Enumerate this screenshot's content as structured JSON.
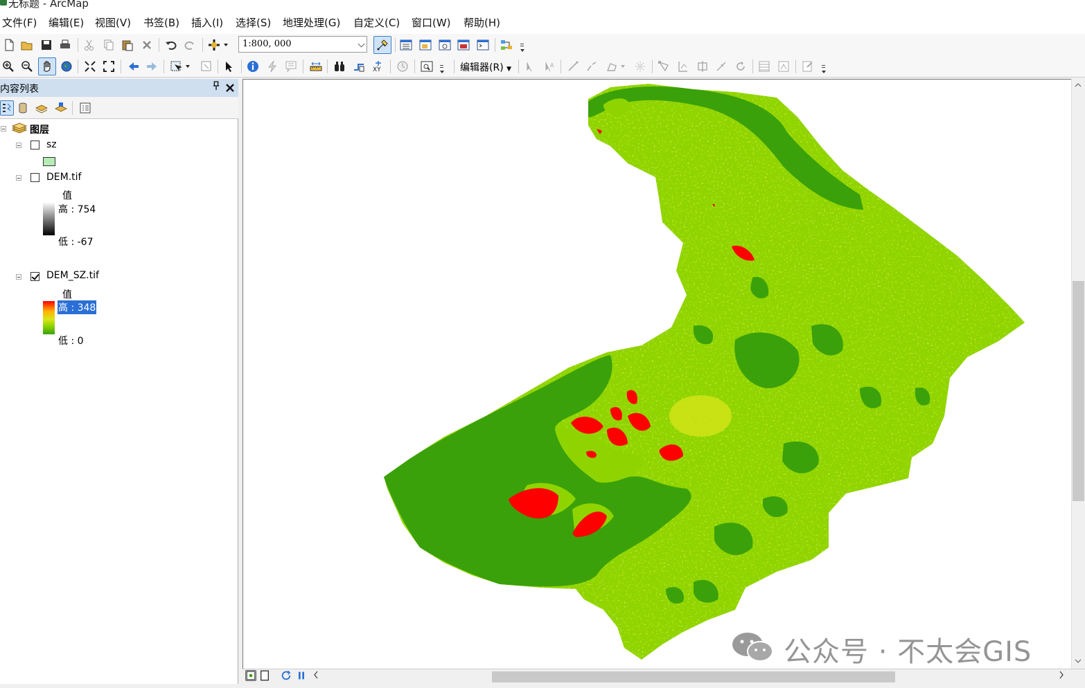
{
  "window": {
    "title": "无标题 - ArcMap"
  },
  "menu": [
    "文件(F)",
    "编辑(E)",
    "视图(V)",
    "书签(B)",
    "插入(I)",
    "选择(S)",
    "地理处理(G)",
    "自定义(C)",
    "窗口(W)",
    "帮助(H)"
  ],
  "toolbar": {
    "scale_value": "1:800, 000",
    "editor_label": "编辑器(R)"
  },
  "toc": {
    "title": "内容列表",
    "pin_glyph": "ᵖ",
    "close_glyph": "×",
    "root": "图层",
    "layers": [
      {
        "name": "sz",
        "checked": false
      },
      {
        "name": "DEM.tif",
        "checked": false,
        "legend_heading": "值",
        "high": "高 : 754",
        "low": "低 : -67"
      },
      {
        "name": "DEM_SZ.tif",
        "checked": true,
        "legend_heading": "值",
        "high": "高 : 348",
        "low": "低 : 0"
      }
    ]
  },
  "colors": {
    "map_dark_green": "#3aa10a",
    "map_light_green": "#8fd400",
    "map_yellow": "#d9e61a",
    "map_red": "#ff0000",
    "sz_fill": "#b6ecb6",
    "toc_header": "#cfdff0",
    "selection": "#2a6fd6"
  },
  "watermark": {
    "text": "公众号 · 不太会GIS"
  }
}
